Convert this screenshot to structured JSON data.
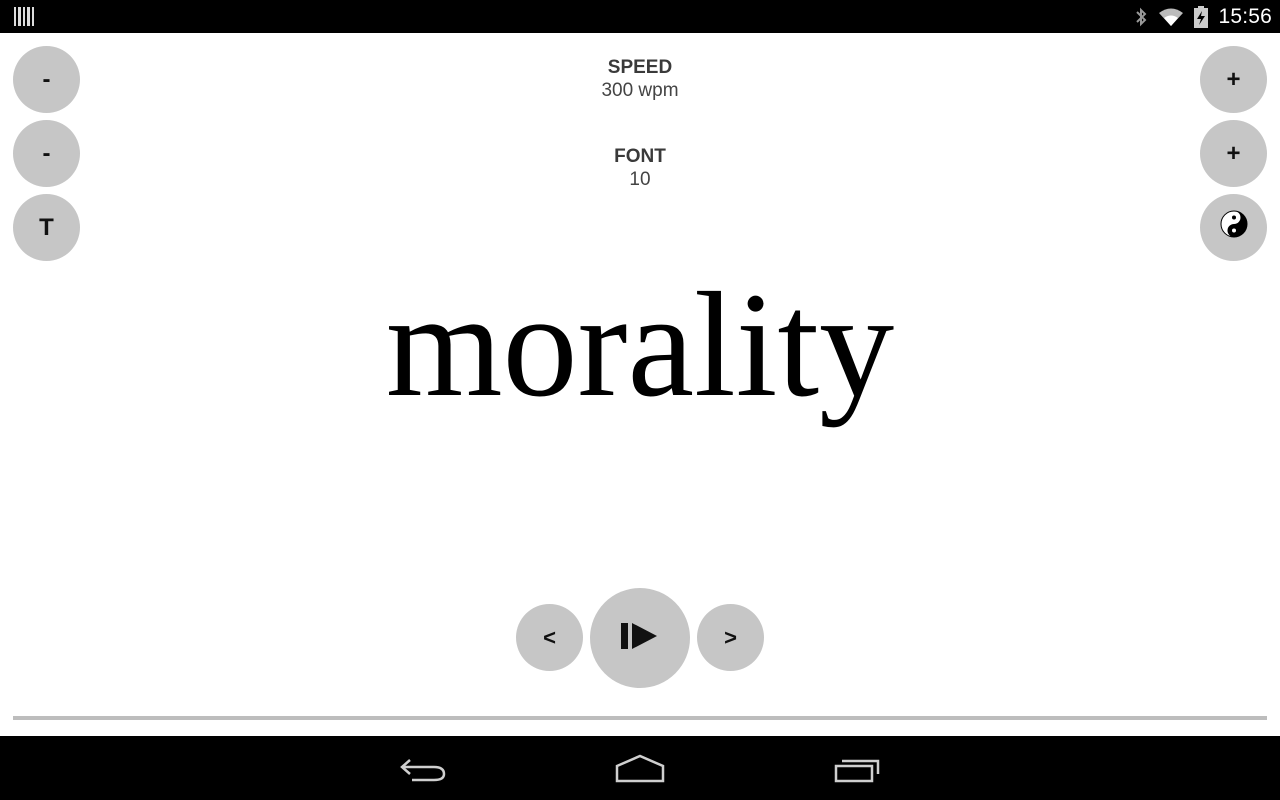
{
  "status_bar": {
    "time": "15:56",
    "icons": [
      "barcode-icon",
      "bluetooth-icon",
      "wifi-icon",
      "battery-charging-icon"
    ]
  },
  "controls": {
    "speed_minus": "-",
    "speed_plus": "+",
    "font_minus": "-",
    "font_plus": "+",
    "typeface_button": "T",
    "theme_toggle_icon": "yin-yang-icon"
  },
  "speed": {
    "title": "SPEED",
    "value": "300 wpm"
  },
  "font": {
    "title": "FONT",
    "value": "10"
  },
  "current_word": "morality",
  "playback": {
    "prev": "<",
    "play_pause_icon": "play-pause-icon",
    "next": ">"
  },
  "nav_bar": {
    "icons": [
      "back-icon",
      "home-icon",
      "recents-icon"
    ]
  }
}
